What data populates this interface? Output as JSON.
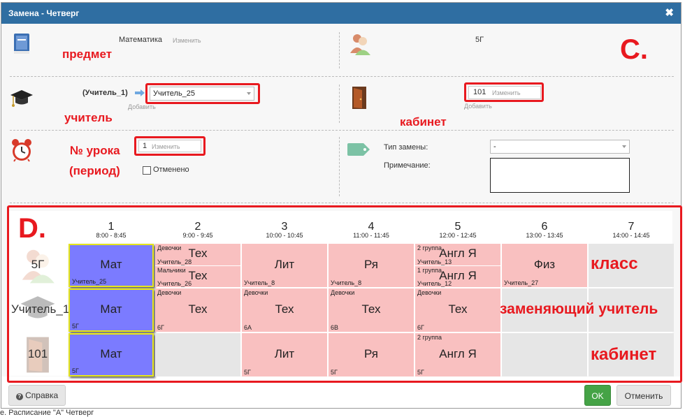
{
  "page_footer": "е. Расписание \"А\" Четверг",
  "dialog": {
    "title": "Замена - Четверг",
    "close_glyph": "✖"
  },
  "subject": {
    "value": "Математика",
    "change": "Изменить",
    "icon": "book-icon"
  },
  "class_info": {
    "value": "5Г",
    "icon": "class-people-icon"
  },
  "teacher": {
    "original": "(Учитель_1)",
    "selected": "Учитель_25",
    "add": "Добавить",
    "icon": "graduation-cap-icon"
  },
  "room": {
    "value": "101",
    "change": "Изменить",
    "add": "Добавить",
    "icon": "door-icon"
  },
  "period": {
    "value": "1",
    "change": "Изменить",
    "cancelled_label": "Отменено",
    "icon": "alarm-clock-icon"
  },
  "replacement": {
    "type_label": "Тип замены:",
    "type_value": "-",
    "note_label": "Примечание:",
    "note_value": "",
    "icon": "tag-icon"
  },
  "annotations": {
    "subject": "предмет",
    "teacher": "учитель",
    "room": "кабинет",
    "period_line1": "№ урока",
    "period_line2": "(период)",
    "section_c": "C.",
    "section_d": "D.",
    "class_row": "класс",
    "teacher_row": "заменяющий учитель",
    "room_row": "кабинет"
  },
  "columns": [
    {
      "num": "1",
      "time": "8:00 - 8:45"
    },
    {
      "num": "2",
      "time": "9:00 - 9:45"
    },
    {
      "num": "3",
      "time": "10:00 - 10:45"
    },
    {
      "num": "4",
      "time": "11:00 - 11:45"
    },
    {
      "num": "5",
      "time": "12:00 - 12:45"
    },
    {
      "num": "6",
      "time": "13:00 - 13:45"
    },
    {
      "num": "7",
      "time": "14:00 - 14:45"
    }
  ],
  "row_labels": {
    "class": "5Г",
    "teacher": "Учитель_1",
    "room": "101"
  },
  "class_row": [
    {
      "main": "Мат",
      "sub": "Учитель_25",
      "style": "blue"
    },
    {
      "split": true,
      "top_top": "Девочки",
      "top_main": "Тех",
      "top_sub": "Учитель_28",
      "bot_top": "Мальчики",
      "bot_main": "Тех",
      "bot_sub": "Учитель_26",
      "style": "pink"
    },
    {
      "main": "Лит",
      "sub": "Учитель_8",
      "style": "pink"
    },
    {
      "main": "Ря",
      "sub": "Учитель_8",
      "style": "pink"
    },
    {
      "split": true,
      "top_top": "2 группа",
      "top_main": "Англ Я",
      "top_sub": "Учитель_13",
      "bot_top": "1 группа",
      "bot_main": "Англ Я",
      "bot_sub": "Учитель_12",
      "style": "pink"
    },
    {
      "main": "Физ",
      "sub": "Учитель_27",
      "style": "pink"
    },
    {
      "main": "",
      "sub": "",
      "style": "gray"
    }
  ],
  "teacher_row": [
    {
      "main": "Мат",
      "sub": "5Г",
      "top": "",
      "style": "blue"
    },
    {
      "main": "Тех",
      "sub": "6Г",
      "top": "Девочки",
      "style": "pink"
    },
    {
      "main": "Тех",
      "sub": "6А",
      "top": "Девочки",
      "style": "pink"
    },
    {
      "main": "Тех",
      "sub": "6В",
      "top": "Девочки",
      "style": "pink"
    },
    {
      "main": "Тех",
      "sub": "6Г",
      "top": "Девочки",
      "style": "pink"
    },
    {
      "main": "",
      "sub": "",
      "top": "",
      "style": "gray"
    },
    {
      "main": "",
      "sub": "",
      "top": "",
      "style": "gray"
    }
  ],
  "room_row": [
    {
      "main": "Мат",
      "sub": "5Г",
      "top": "",
      "style": "blue"
    },
    {
      "main": "",
      "sub": "",
      "top": "",
      "style": "gray"
    },
    {
      "main": "Лит",
      "sub": "5Г",
      "top": "",
      "style": "pink"
    },
    {
      "main": "Ря",
      "sub": "5Г",
      "top": "",
      "style": "pink"
    },
    {
      "main": "Англ Я",
      "sub": "5Г",
      "top": "2 группа",
      "style": "pink"
    },
    {
      "main": "",
      "sub": "",
      "top": "",
      "style": "gray"
    },
    {
      "main": "",
      "sub": "",
      "top": "",
      "style": "gray"
    }
  ],
  "footer": {
    "help": "Справка",
    "ok": "OK",
    "cancel": "Отменить"
  },
  "colors": {
    "titlebar": "#2f6ea2",
    "selected_cell": "#7b7bff",
    "lesson_cell": "#f9c0c0",
    "empty_cell": "#e6e6e6",
    "annotation": "#e8191f",
    "ok_button": "#45a346"
  }
}
